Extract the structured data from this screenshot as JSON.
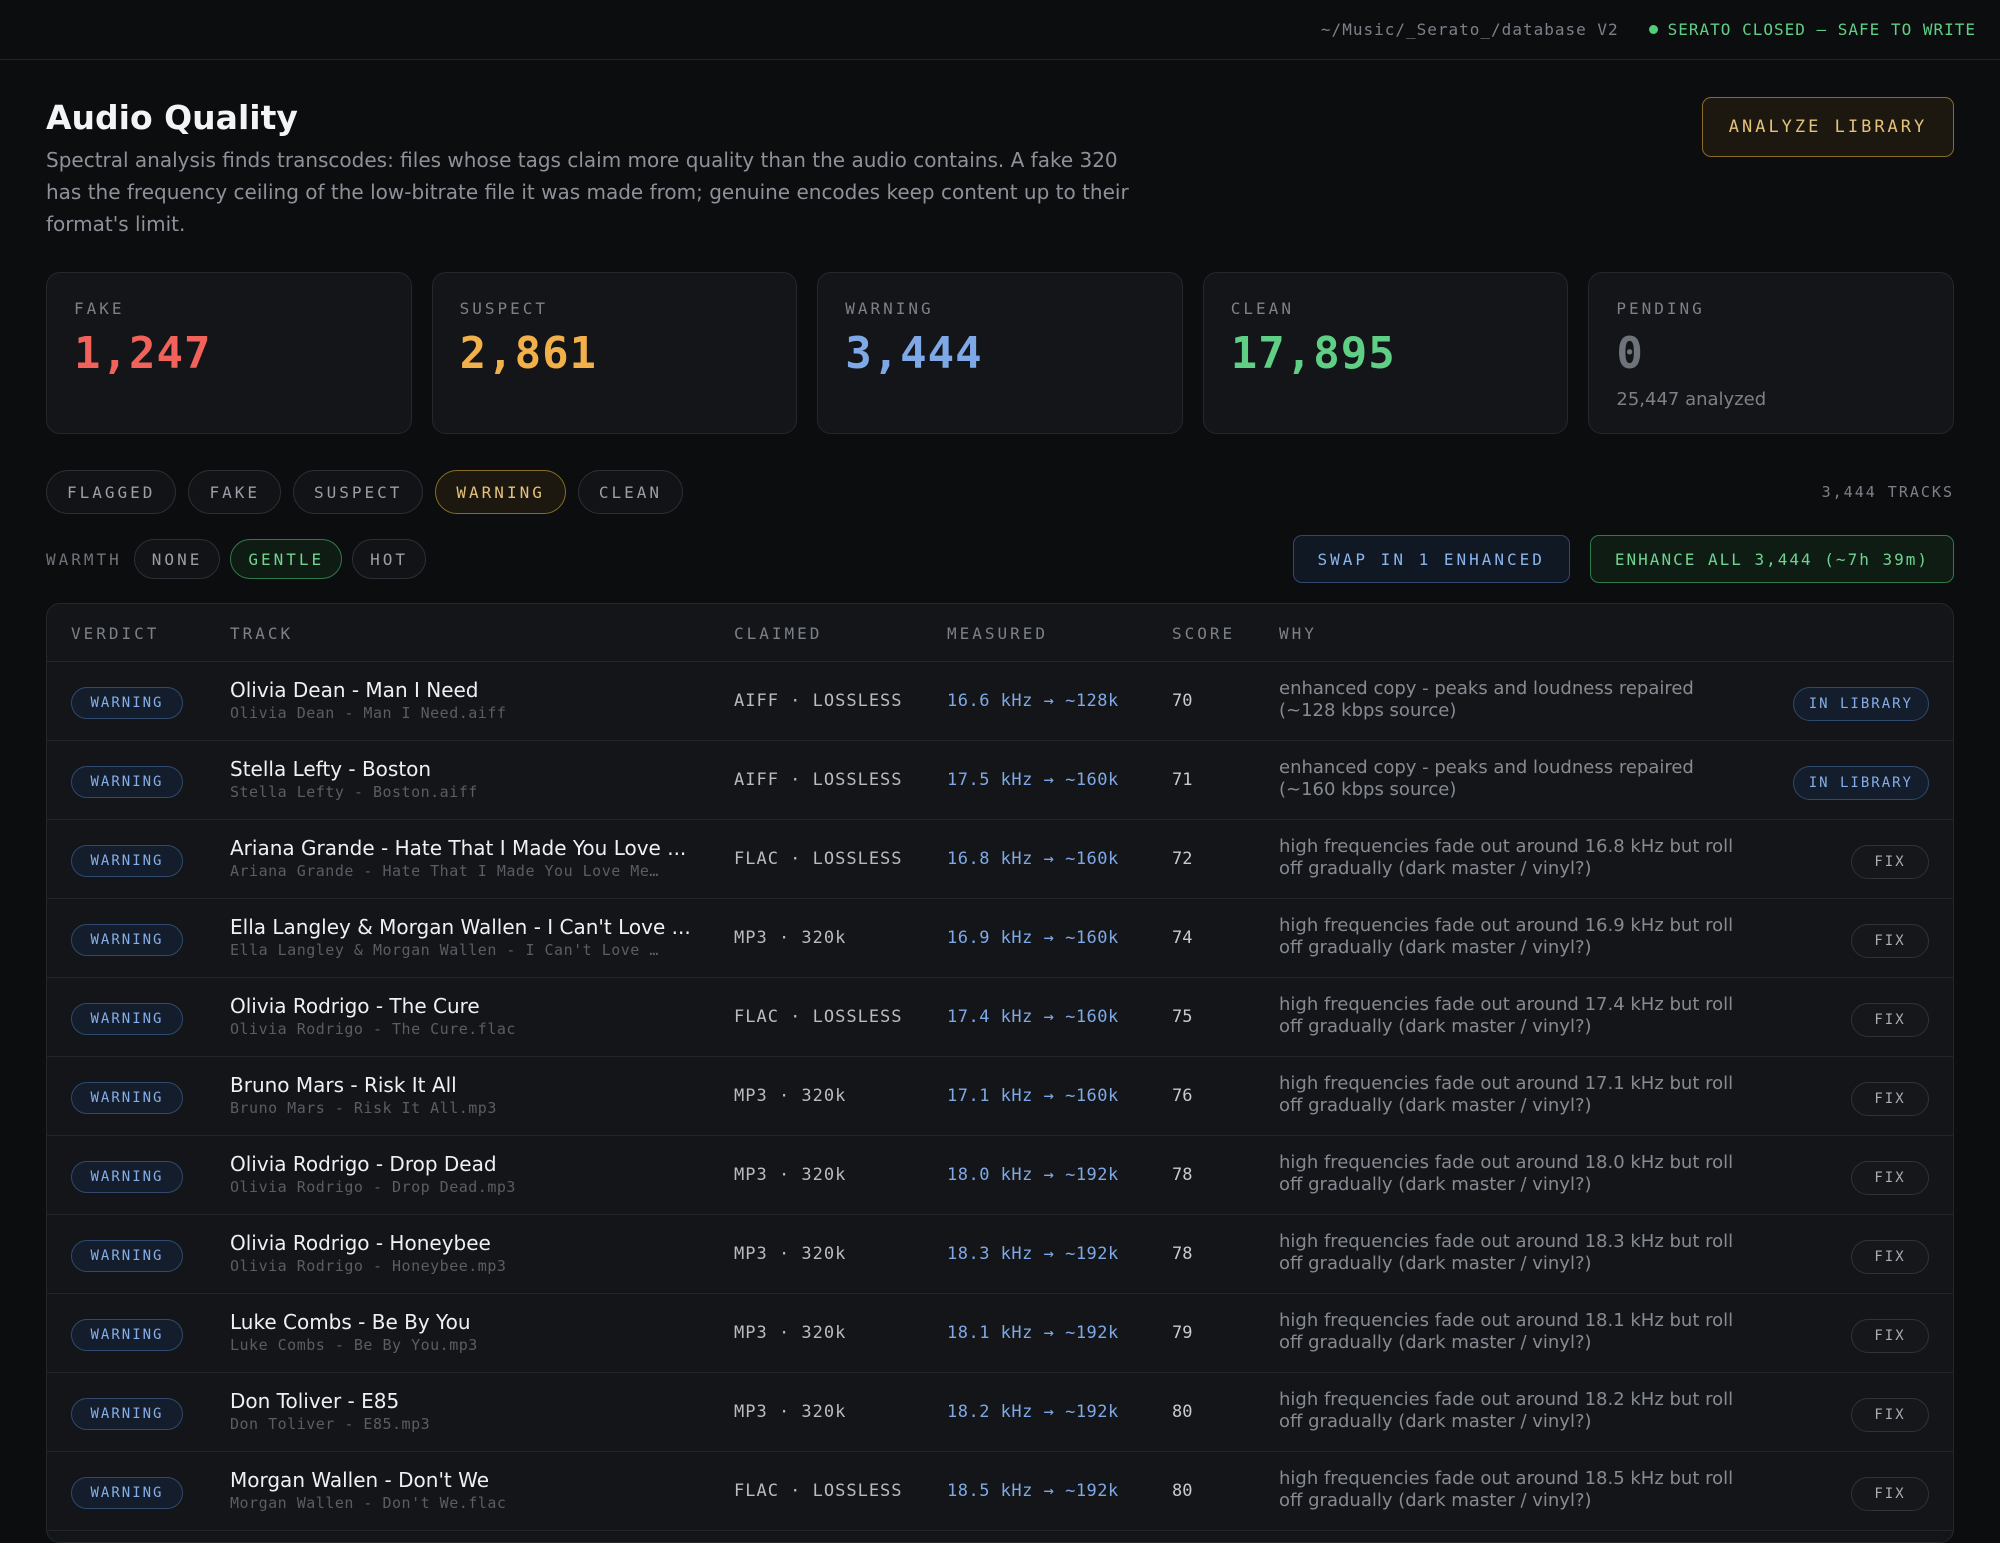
{
  "topbar": {
    "path": "~/Music/_Serato_/database V2",
    "status": "SERATO CLOSED — SAFE TO WRITE"
  },
  "header": {
    "title": "Audio Quality",
    "description": "Spectral analysis finds transcodes: files whose tags claim more quality than the audio contains. A fake 320 has the frequency ceiling of the low-bitrate file it was made from; genuine encodes keep content up to their format's limit.",
    "analyze_label": "ANALYZE LIBRARY"
  },
  "stats": [
    {
      "label": "FAKE",
      "value": "1,247",
      "color": "#f0625a",
      "sub": ""
    },
    {
      "label": "SUSPECT",
      "value": "2,861",
      "color": "#f2b04a",
      "sub": ""
    },
    {
      "label": "WARNING",
      "value": "3,444",
      "color": "#7fa9e6",
      "sub": ""
    },
    {
      "label": "CLEAN",
      "value": "17,895",
      "color": "#5fcf85",
      "sub": ""
    },
    {
      "label": "PENDING",
      "value": "0",
      "color": "#6e727a",
      "sub": "25,447 analyzed"
    }
  ],
  "filters": {
    "items": [
      "FLAGGED",
      "FAKE",
      "SUSPECT",
      "WARNING",
      "CLEAN"
    ],
    "active": "WARNING",
    "track_count": "3,444 TRACKS"
  },
  "warmth": {
    "label": "WARMTH",
    "items": [
      "NONE",
      "GENTLE",
      "HOT"
    ],
    "active": "GENTLE",
    "swap_label": "SWAP IN 1 ENHANCED",
    "enhance_label": "ENHANCE ALL 3,444 (~7h 39m)"
  },
  "table": {
    "headers": {
      "verdict": "VERDICT",
      "track": "TRACK",
      "claimed": "CLAIMED",
      "measured": "MEASURED",
      "score": "SCORE",
      "why": "WHY"
    },
    "rows": [
      {
        "verdict": "WARNING",
        "title": "Olivia Dean - Man I Need",
        "file": "Olivia Dean - Man I Need.aiff",
        "claimed": "AIFF · LOSSLESS",
        "measured": "16.6 kHz → ~128k",
        "score": "70",
        "why": "enhanced copy - peaks and loudness repaired (~128 kbps source)",
        "action": "IN LIBRARY"
      },
      {
        "verdict": "WARNING",
        "title": "Stella Lefty - Boston",
        "file": "Stella Lefty - Boston.aiff",
        "claimed": "AIFF · LOSSLESS",
        "measured": "17.5 kHz → ~160k",
        "score": "71",
        "why": "enhanced copy - peaks and loudness repaired (~160 kbps source)",
        "action": "IN LIBRARY"
      },
      {
        "verdict": "WARNING",
        "title": "Ariana Grande - Hate That I Made You Love ...",
        "file": "Ariana Grande - Hate That I Made You Love Me…",
        "claimed": "FLAC · LOSSLESS",
        "measured": "16.8 kHz → ~160k",
        "score": "72",
        "why": "high frequencies fade out around 16.8 kHz but roll off gradually (dark master / vinyl?)",
        "action": "FIX"
      },
      {
        "verdict": "WARNING",
        "title": "Ella Langley & Morgan Wallen - I Can't Love ...",
        "file": "Ella Langley & Morgan Wallen - I Can't Love …",
        "claimed": "MP3 · 320k",
        "measured": "16.9 kHz → ~160k",
        "score": "74",
        "why": "high frequencies fade out around 16.9 kHz but roll off gradually (dark master / vinyl?)",
        "action": "FIX"
      },
      {
        "verdict": "WARNING",
        "title": "Olivia Rodrigo - The Cure",
        "file": "Olivia Rodrigo - The Cure.flac",
        "claimed": "FLAC · LOSSLESS",
        "measured": "17.4 kHz → ~160k",
        "score": "75",
        "why": "high frequencies fade out around 17.4 kHz but roll off gradually (dark master / vinyl?)",
        "action": "FIX"
      },
      {
        "verdict": "WARNING",
        "title": "Bruno Mars - Risk It All",
        "file": "Bruno Mars - Risk It All.mp3",
        "claimed": "MP3 · 320k",
        "measured": "17.1 kHz → ~160k",
        "score": "76",
        "why": "high frequencies fade out around 17.1 kHz but roll off gradually (dark master / vinyl?)",
        "action": "FIX"
      },
      {
        "verdict": "WARNING",
        "title": "Olivia Rodrigo - Drop Dead",
        "file": "Olivia Rodrigo - Drop Dead.mp3",
        "claimed": "MP3 · 320k",
        "measured": "18.0 kHz → ~192k",
        "score": "78",
        "why": "high frequencies fade out around 18.0 kHz but roll off gradually (dark master / vinyl?)",
        "action": "FIX"
      },
      {
        "verdict": "WARNING",
        "title": "Olivia Rodrigo - Honeybee",
        "file": "Olivia Rodrigo - Honeybee.mp3",
        "claimed": "MP3 · 320k",
        "measured": "18.3 kHz → ~192k",
        "score": "78",
        "why": "high frequencies fade out around 18.3 kHz but roll off gradually (dark master / vinyl?)",
        "action": "FIX"
      },
      {
        "verdict": "WARNING",
        "title": "Luke Combs - Be By You",
        "file": "Luke Combs - Be By You.mp3",
        "claimed": "MP3 · 320k",
        "measured": "18.1 kHz → ~192k",
        "score": "79",
        "why": "high frequencies fade out around 18.1 kHz but roll off gradually (dark master / vinyl?)",
        "action": "FIX"
      },
      {
        "verdict": "WARNING",
        "title": "Don Toliver - E85",
        "file": "Don Toliver - E85.mp3",
        "claimed": "MP3 · 320k",
        "measured": "18.2 kHz → ~192k",
        "score": "80",
        "why": "high frequencies fade out around 18.2 kHz but roll off gradually (dark master / vinyl?)",
        "action": "FIX"
      },
      {
        "verdict": "WARNING",
        "title": "Morgan Wallen - Don't We",
        "file": "Morgan Wallen - Don't We.flac",
        "claimed": "FLAC · LOSSLESS",
        "measured": "18.5 kHz → ~192k",
        "score": "80",
        "why": "high frequencies fade out around 18.5 kHz but roll off gradually (dark master / vinyl?)",
        "action": "FIX"
      }
    ]
  }
}
